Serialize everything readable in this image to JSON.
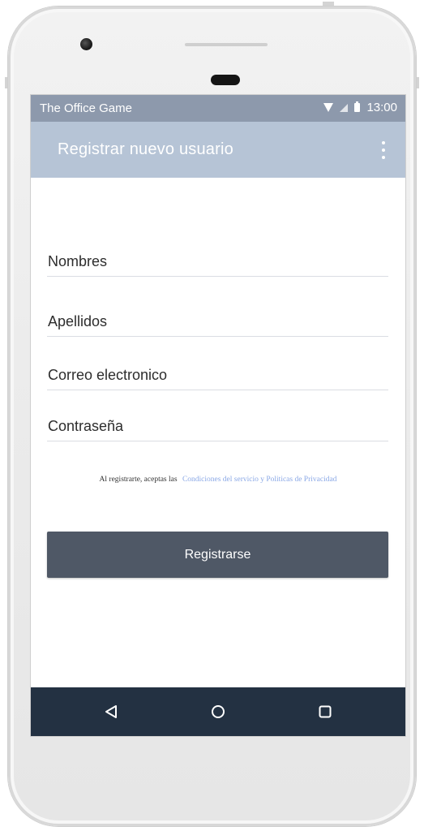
{
  "status_bar": {
    "app_name": "The Office Game",
    "time": "13:00",
    "icons": [
      "wifi-icon",
      "signal-icon",
      "battery-icon"
    ]
  },
  "app_bar": {
    "title": "Registrar nuevo usuario",
    "menu_icon": "more-vert-icon"
  },
  "form": {
    "first_name_placeholder": "Nombres",
    "last_name_placeholder": "Apellidos",
    "email_placeholder": "Correo electronico",
    "password_placeholder": "Contraseña"
  },
  "terms": {
    "prefix": "Al registrarte, aceptas las",
    "link": "Condiciones del servicio y Politicas de Privacidad"
  },
  "register_button": {
    "label": "Registrarse"
  },
  "navigation": {
    "icons": [
      "back-icon",
      "home-icon",
      "recents-icon"
    ]
  },
  "colors": {
    "status_bar": "#8d99ac",
    "app_bar": "#b6c4d6",
    "button": "#4f5866",
    "nav_bar": "#233142",
    "link": "#8aa8e6"
  }
}
